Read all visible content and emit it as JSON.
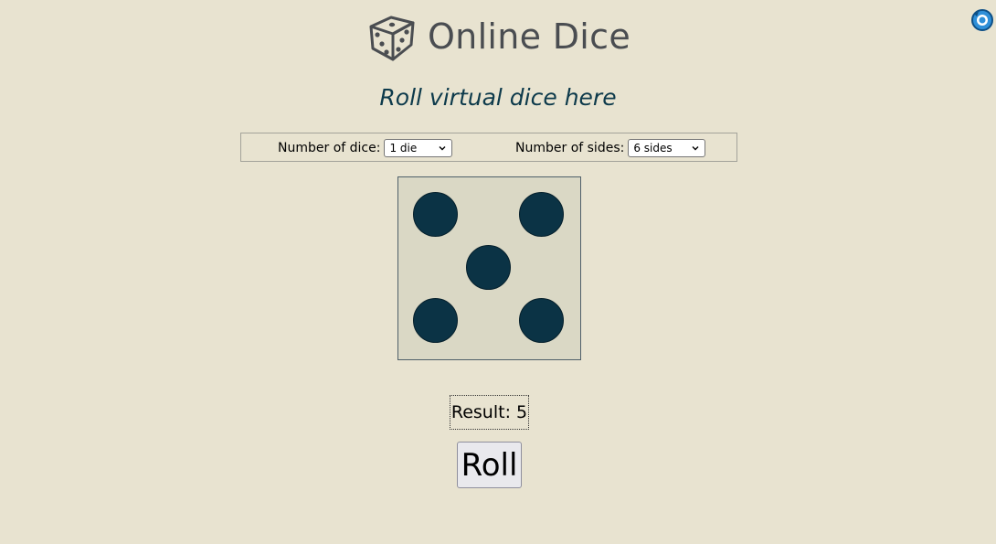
{
  "header": {
    "title": "Online Dice",
    "logo_icon": "dice-icon"
  },
  "corner": {
    "icon": "extension-icon",
    "color": "#2e8fd8"
  },
  "subtitle": "Roll virtual dice here",
  "controls": {
    "dice_count": {
      "label": "Number of dice:",
      "value": "1 die"
    },
    "sides": {
      "label": "Number of sides:",
      "value": "6 sides"
    }
  },
  "die": {
    "face_value": 5,
    "pip_color": "#0b3345",
    "face_color": "#dad8c5"
  },
  "result": {
    "text": "Result: 5"
  },
  "roll_button": {
    "label": "Roll"
  },
  "colors": {
    "background": "#e8e3d0",
    "title": "#4a4d51",
    "subtitle": "#0d3a4b"
  }
}
